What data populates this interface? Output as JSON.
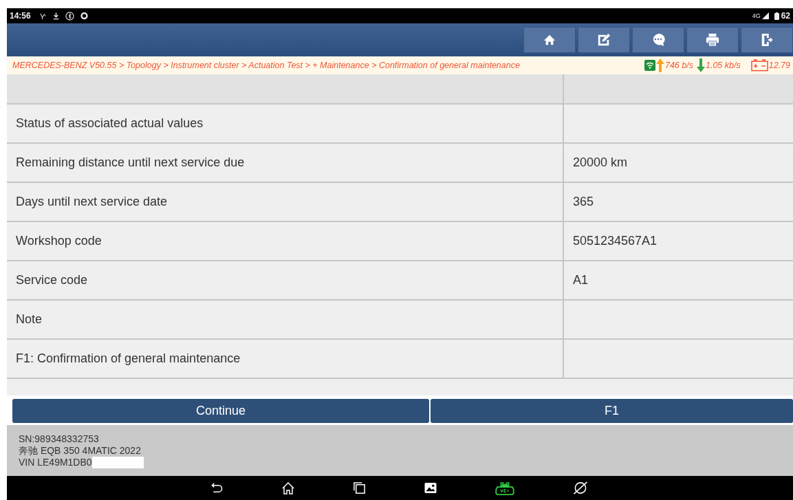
{
  "status_bar": {
    "time": "14:56",
    "network": "4G",
    "battery": "62"
  },
  "toolbar": {
    "buttons": [
      {
        "kind": "home"
      },
      {
        "kind": "edit"
      },
      {
        "kind": "chat"
      },
      {
        "kind": "print"
      },
      {
        "kind": "exit"
      }
    ]
  },
  "breadcrumb": {
    "path": "MERCEDES-BENZ V50.55 > Topology > Instrument cluster > Actuation Test > + Maintenance > Confirmation of general maintenance",
    "upload": "746 b/s",
    "download": "1.05 kb/s",
    "voltage": "12.79"
  },
  "table": {
    "rows": [
      {
        "label": "Status of associated actual values",
        "value": ""
      },
      {
        "label": "Remaining distance until next service due",
        "value": "20000 km"
      },
      {
        "label": "Days until next service date",
        "value": "365"
      },
      {
        "label": "Workshop code",
        "value": "5051234567A1"
      },
      {
        "label": "Service code",
        "value": "A1"
      },
      {
        "label": "Note",
        "value": ""
      },
      {
        "label": "F1: Confirmation of general maintenance",
        "value": ""
      }
    ]
  },
  "actions": [
    "Continue",
    "F1"
  ],
  "vehicle_info": {
    "serial": "SN:989348332753",
    "model": "奔驰 EQB 350 4MATIC 2022",
    "vin": "VIN LE49M1DB0"
  },
  "nav_bar": {
    "buttons": [
      {
        "kind": "back"
      },
      {
        "kind": "home"
      },
      {
        "kind": "recents"
      },
      {
        "kind": "gallery"
      },
      {
        "kind": "vci"
      },
      {
        "kind": "browser"
      }
    ]
  }
}
